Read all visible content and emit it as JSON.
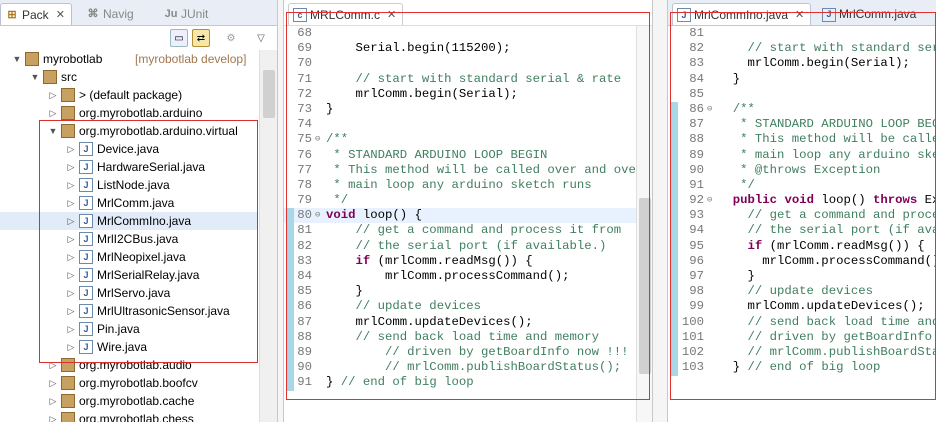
{
  "explorer": {
    "tabs": [
      {
        "label": "Pack",
        "active": true
      },
      {
        "label": "Navig",
        "active": false
      },
      {
        "label": "JUnit",
        "active": false
      }
    ],
    "tree": [
      {
        "label": "myrobotlab",
        "suffix": "[myrobotlab develop]",
        "depth": 0,
        "twisty": "▼",
        "icon": "project-icon"
      },
      {
        "label": "src",
        "depth": 1,
        "twisty": "▼",
        "icon": "source-folder-icon"
      },
      {
        "label": "> (default package)",
        "depth": 2,
        "twisty": "▷",
        "icon": "package-icon"
      },
      {
        "label": "org.myrobotlab.arduino",
        "depth": 2,
        "twisty": "▷",
        "icon": "package-icon"
      },
      {
        "label": "org.myrobotlab.arduino.virtual",
        "depth": 2,
        "twisty": "▼",
        "icon": "package-icon"
      },
      {
        "label": "Device.java",
        "depth": 3,
        "twisty": "▷",
        "icon": "java-file-icon"
      },
      {
        "label": "HardwareSerial.java",
        "depth": 3,
        "twisty": "▷",
        "icon": "java-file-icon"
      },
      {
        "label": "ListNode.java",
        "depth": 3,
        "twisty": "▷",
        "icon": "java-file-icon"
      },
      {
        "label": "MrlComm.java",
        "depth": 3,
        "twisty": "▷",
        "icon": "java-file-icon"
      },
      {
        "label": "MrlCommIno.java",
        "depth": 3,
        "twisty": "▷",
        "icon": "java-file-icon",
        "selected": true
      },
      {
        "label": "MrlI2CBus.java",
        "depth": 3,
        "twisty": "▷",
        "icon": "java-file-icon"
      },
      {
        "label": "MrlNeopixel.java",
        "depth": 3,
        "twisty": "▷",
        "icon": "java-file-icon"
      },
      {
        "label": "MrlSerialRelay.java",
        "depth": 3,
        "twisty": "▷",
        "icon": "java-file-icon"
      },
      {
        "label": "MrlServo.java",
        "depth": 3,
        "twisty": "▷",
        "icon": "java-file-icon"
      },
      {
        "label": "MrlUltrasonicSensor.java",
        "depth": 3,
        "twisty": "▷",
        "icon": "java-file-icon"
      },
      {
        "label": "Pin.java",
        "depth": 3,
        "twisty": "▷",
        "icon": "java-file-icon"
      },
      {
        "label": "Wire.java",
        "depth": 3,
        "twisty": "▷",
        "icon": "java-file-icon"
      },
      {
        "label": "org.myrobotlab.audio",
        "depth": 2,
        "twisty": "▷",
        "icon": "package-icon"
      },
      {
        "label": "org.myrobotlab.boofcv",
        "depth": 2,
        "twisty": "▷",
        "icon": "package-icon"
      },
      {
        "label": "org.myrobotlab.cache",
        "depth": 2,
        "twisty": "▷",
        "icon": "package-icon"
      },
      {
        "label": "org.myrobotlab.chess",
        "depth": 2,
        "twisty": "▷",
        "icon": "package-icon"
      }
    ]
  },
  "editor_left": {
    "tab": "MRLComm.c",
    "lines": [
      {
        "n": "68",
        "t": ""
      },
      {
        "n": "69",
        "t": "    Serial.begin(115200);"
      },
      {
        "n": "70",
        "t": ""
      },
      {
        "n": "71",
        "t": "    // start with standard serial & rate",
        "c": true
      },
      {
        "n": "72",
        "t": "    mrlComm.begin(Serial);"
      },
      {
        "n": "73",
        "t": "}"
      },
      {
        "n": "74",
        "t": ""
      },
      {
        "n": "75",
        "t": "/**",
        "c": true,
        "fold": true
      },
      {
        "n": "76",
        "t": " * STANDARD ARDUINO LOOP BEGIN",
        "c": true
      },
      {
        "n": "77",
        "t": " * This method will be called over and over",
        "c": true
      },
      {
        "n": "78",
        "t": " * main loop any arduino sketch runs",
        "c": true
      },
      {
        "n": "79",
        "t": " */",
        "c": true
      },
      {
        "n": "80",
        "t": "void loop() {",
        "fold": true,
        "hl": true
      },
      {
        "n": "81",
        "t": "    // get a command and process it from",
        "c": true
      },
      {
        "n": "82",
        "t": "    // the serial port (if available.)",
        "c": true
      },
      {
        "n": "83",
        "t": "    if (mrlComm.readMsg()) {"
      },
      {
        "n": "84",
        "t": "        mrlComm.processCommand();"
      },
      {
        "n": "85",
        "t": "    }"
      },
      {
        "n": "86",
        "t": "    // update devices",
        "c": true
      },
      {
        "n": "87",
        "t": "    mrlComm.updateDevices();"
      },
      {
        "n": "88",
        "t": "    // send back load time and memory",
        "c": true
      },
      {
        "n": "89",
        "t": "        // driven by getBoardInfo now !!!",
        "c": true
      },
      {
        "n": "90",
        "t": "        // mrlComm.publishBoardStatus();",
        "c": true
      },
      {
        "n": "91",
        "t": "} // end of big loop",
        "tailc": "// end of big loop"
      }
    ]
  },
  "editor_right": {
    "tabs": [
      {
        "label": "MrlCommIno.java",
        "active": true
      },
      {
        "label": "MrlComm.java",
        "active": false
      }
    ],
    "lines": [
      {
        "n": "81",
        "t": ""
      },
      {
        "n": "82",
        "t": "    // start with standard seri",
        "c": true
      },
      {
        "n": "83",
        "t": "    mrlComm.begin(Serial);"
      },
      {
        "n": "84",
        "t": "  }"
      },
      {
        "n": "85",
        "t": ""
      },
      {
        "n": "86",
        "t": "  /**",
        "c": true,
        "fold": true
      },
      {
        "n": "87",
        "t": "   * STANDARD ARDUINO LOOP BEGI",
        "c": true
      },
      {
        "n": "88",
        "t": "   * This method will be called",
        "c": true
      },
      {
        "n": "89",
        "t": "   * main loop any arduino sket",
        "c": true
      },
      {
        "n": "90",
        "t": "   * @throws Exception",
        "c": true
      },
      {
        "n": "91",
        "t": "   */",
        "c": true
      },
      {
        "n": "92",
        "t": "  public void loop() throws Exc",
        "fold": true
      },
      {
        "n": "93",
        "t": "    // get a command and proces",
        "c": true
      },
      {
        "n": "94",
        "t": "    // the serial port (if avai",
        "c": true
      },
      {
        "n": "95",
        "t": "    if (mrlComm.readMsg()) {"
      },
      {
        "n": "96",
        "t": "      mrlComm.processCommand();"
      },
      {
        "n": "97",
        "t": "    }"
      },
      {
        "n": "98",
        "t": "    // update devices",
        "c": true
      },
      {
        "n": "99",
        "t": "    mrlComm.updateDevices();"
      },
      {
        "n": "100",
        "t": "    // send back load time and",
        "c": true
      },
      {
        "n": "101",
        "t": "    // driven by getBoardInfo n",
        "c": true
      },
      {
        "n": "102",
        "t": "    // mrlComm.publishBoardStat",
        "c": true
      },
      {
        "n": "103",
        "t": "  } // end of big loop",
        "tailc": "// end of big loop"
      }
    ]
  },
  "colors": {
    "highlight_box": "#e03030",
    "comment": "#3f7f5f",
    "keyword": "#7f0055"
  }
}
